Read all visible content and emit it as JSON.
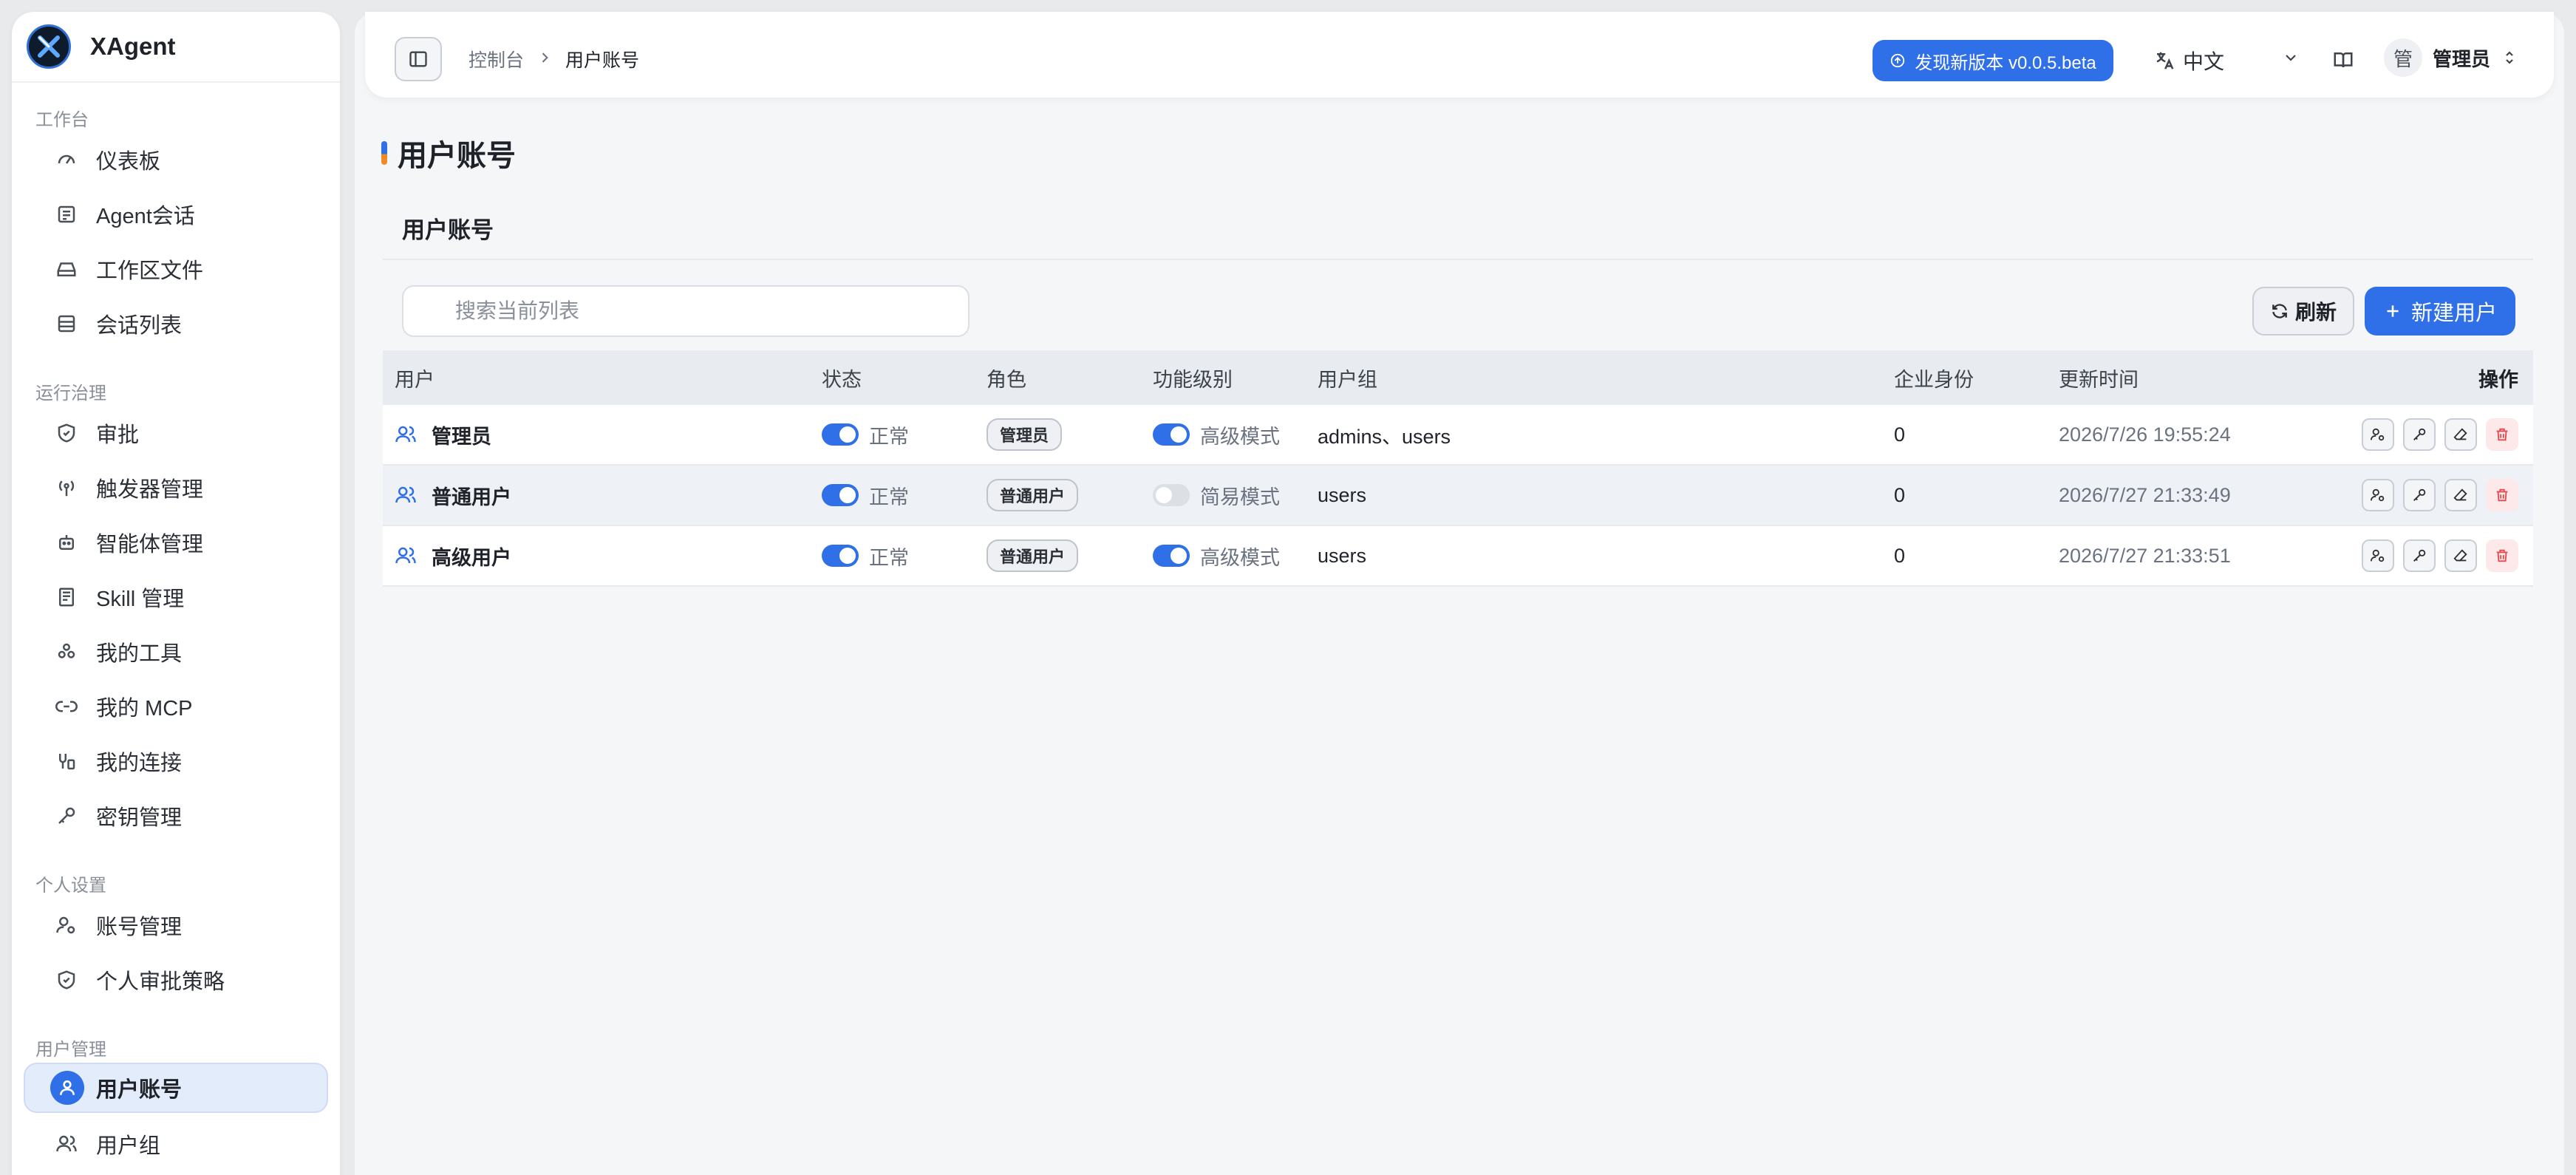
{
  "brand": {
    "name": "XAgent"
  },
  "sidebar": {
    "sections": [
      {
        "title": "工作台",
        "items": [
          "仪表板",
          "Agent会话",
          "工作区文件",
          "会话列表"
        ]
      },
      {
        "title": "运行治理",
        "items": [
          "审批",
          "触发器管理",
          "智能体管理",
          "Skill 管理",
          "我的工具",
          "我的 MCP",
          "我的连接",
          "密钥管理"
        ]
      },
      {
        "title": "个人设置",
        "items": [
          "账号管理",
          "个人审批策略"
        ]
      },
      {
        "title": "用户管理",
        "items": [
          "用户账号",
          "用户组"
        ]
      }
    ],
    "active": "用户账号"
  },
  "topbar": {
    "breadcrumb": [
      "控制台",
      "用户账号"
    ],
    "update_label": "发现新版本 v0.0.5.beta",
    "language": "中文",
    "avatar_char": "管",
    "user_name": "管理员"
  },
  "page": {
    "title": "用户账号",
    "card_title": "用户账号"
  },
  "search": {
    "placeholder": "搜索当前列表"
  },
  "buttons": {
    "refresh": "刷新",
    "new_user": "新建用户"
  },
  "table": {
    "headers": [
      "用户",
      "状态",
      "角色",
      "功能级别",
      "用户组",
      "企业身份",
      "更新时间",
      "操作"
    ],
    "rows": [
      {
        "user": "管理员",
        "status_on": true,
        "status": "正常",
        "role": "管理员",
        "level_on": true,
        "level": "高级模式",
        "groups": "admins、users",
        "enterprise": "0",
        "updated": "2026/7/26 19:55:24"
      },
      {
        "user": "普通用户",
        "status_on": true,
        "status": "正常",
        "role": "普通用户",
        "level_on": false,
        "level": "简易模式",
        "groups": "users",
        "enterprise": "0",
        "updated": "2026/7/27 21:33:49"
      },
      {
        "user": "高级用户",
        "status_on": true,
        "status": "正常",
        "role": "普通用户",
        "level_on": true,
        "level": "高级模式",
        "groups": "users",
        "enterprise": "0",
        "updated": "2026/7/27 21:33:51"
      }
    ]
  },
  "colors": {
    "accent": "#2f6fe8",
    "danger": "#e5484d",
    "indicator_orange": "#f08a24"
  },
  "icons": [
    "dashboard-icon",
    "chat-icon",
    "drive-icon",
    "list-icon",
    "shield-icon",
    "antenna-icon",
    "robot-icon",
    "book-icon",
    "tools-icon",
    "link-icon",
    "connection-icon",
    "key-icon",
    "user-gear-icon",
    "shield-check-icon",
    "user-icon",
    "users-icon"
  ]
}
